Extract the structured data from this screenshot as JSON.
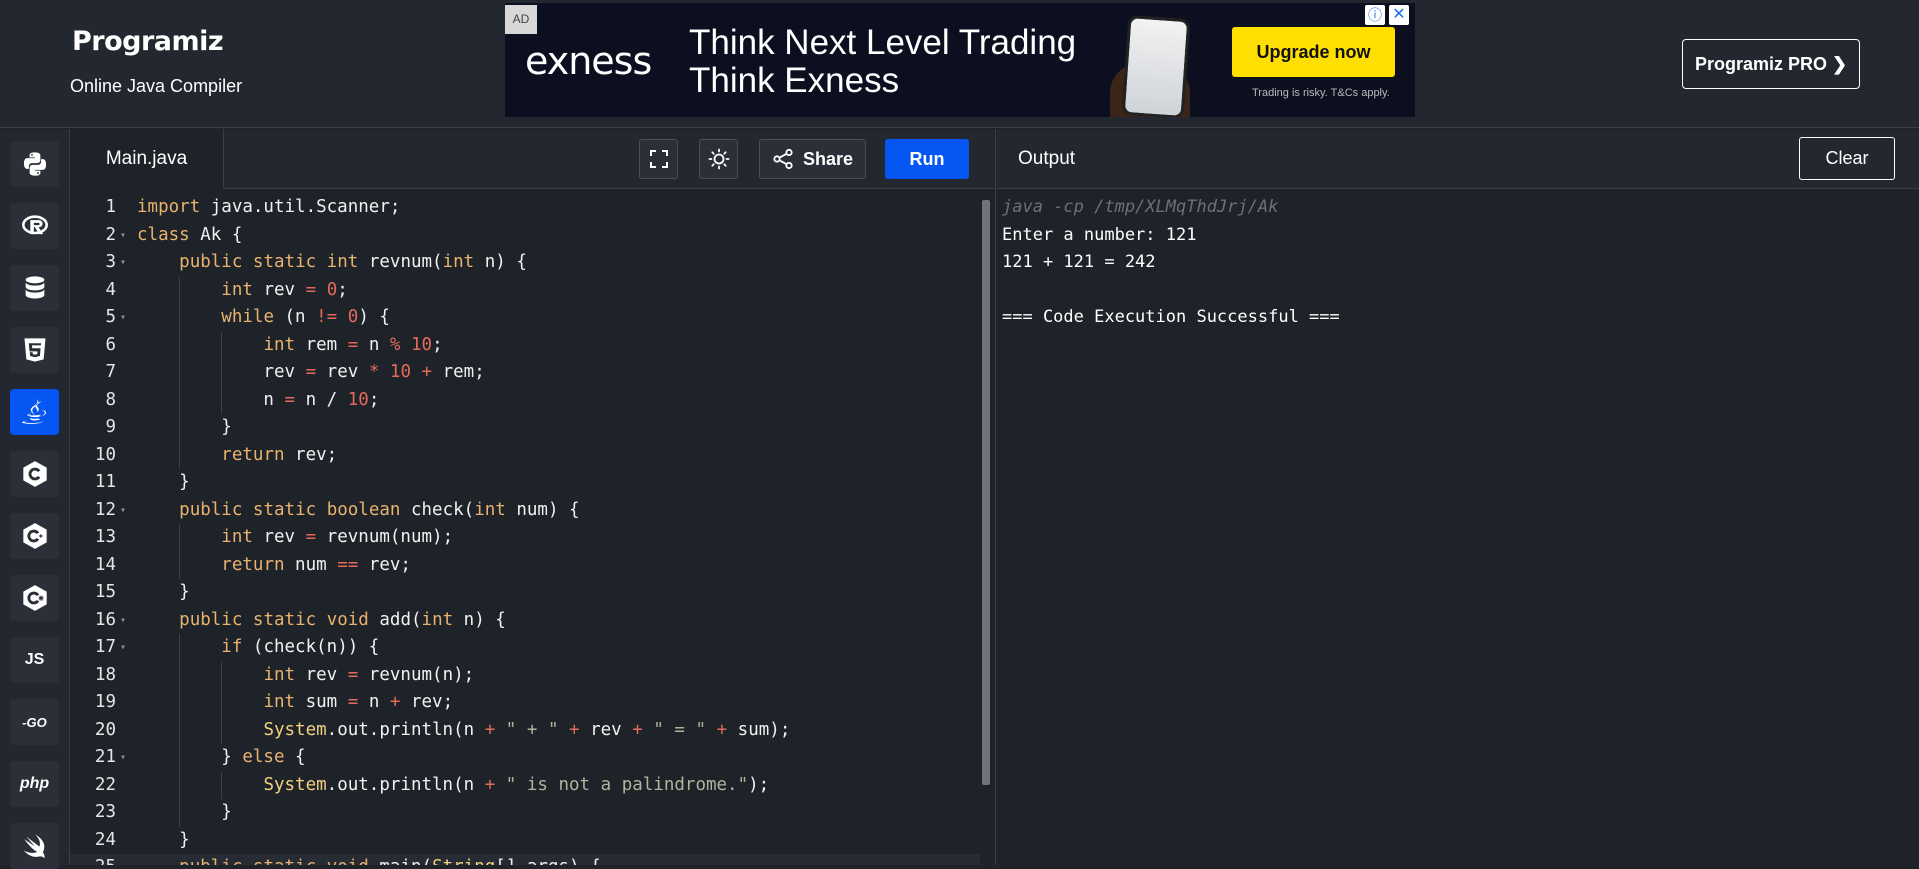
{
  "header": {
    "logo_text": "Programiz",
    "subtitle": "Online Java Compiler",
    "pro_button": "Programiz PRO ❯"
  },
  "ad": {
    "tag": "AD",
    "brand": "exness",
    "line1": "Think Next Level Trading",
    "line2": "Think Exness",
    "cta": "Upgrade now",
    "risk": "Trading is risky. T&Cs apply.",
    "info_icon": "ⓘ",
    "close_icon": "✕"
  },
  "sidebar": {
    "items": [
      {
        "name": "python",
        "label": ""
      },
      {
        "name": "r",
        "label": ""
      },
      {
        "name": "sql",
        "label": ""
      },
      {
        "name": "html",
        "label": ""
      },
      {
        "name": "java",
        "label": "",
        "active": true
      },
      {
        "name": "c",
        "label": ""
      },
      {
        "name": "cpp",
        "label": ""
      },
      {
        "name": "csharp",
        "label": ""
      },
      {
        "name": "js",
        "label": "JS"
      },
      {
        "name": "go",
        "label": "-GO"
      },
      {
        "name": "php",
        "label": "php"
      },
      {
        "name": "swift",
        "label": ""
      }
    ]
  },
  "editor": {
    "file_tab": "Main.java",
    "share_label": "Share",
    "run_label": "Run",
    "lines": [
      "import java.util.Scanner;",
      "class Ak {",
      "    public static int revnum(int n) {",
      "        int rev = 0;",
      "        while (n != 0) {",
      "            int rem = n % 10;",
      "            rev = rev * 10 + rem;",
      "            n = n / 10;",
      "        }",
      "        return rev;",
      "    }",
      "    public static boolean check(int num) {",
      "        int rev = revnum(num);",
      "        return num == rev;",
      "    }",
      "    public static void add(int n) {",
      "        if (check(n)) {",
      "            int rev = revnum(n);",
      "            int sum = n + rev;",
      "            System.out.println(n + \" + \" + rev + \" = \" + sum);",
      "        } else {",
      "            System.out.println(n + \" is not a palindrome.\");",
      "        }",
      "    }",
      "    public static void main(String[] args) {"
    ]
  },
  "output": {
    "title": "Output",
    "clear_label": "Clear",
    "lines": [
      "java -cp /tmp/XLMqThdJrj/Ak",
      "Enter a number: 121",
      "121 + 121 = 242",
      "",
      "=== Code Execution Successful ==="
    ]
  }
}
